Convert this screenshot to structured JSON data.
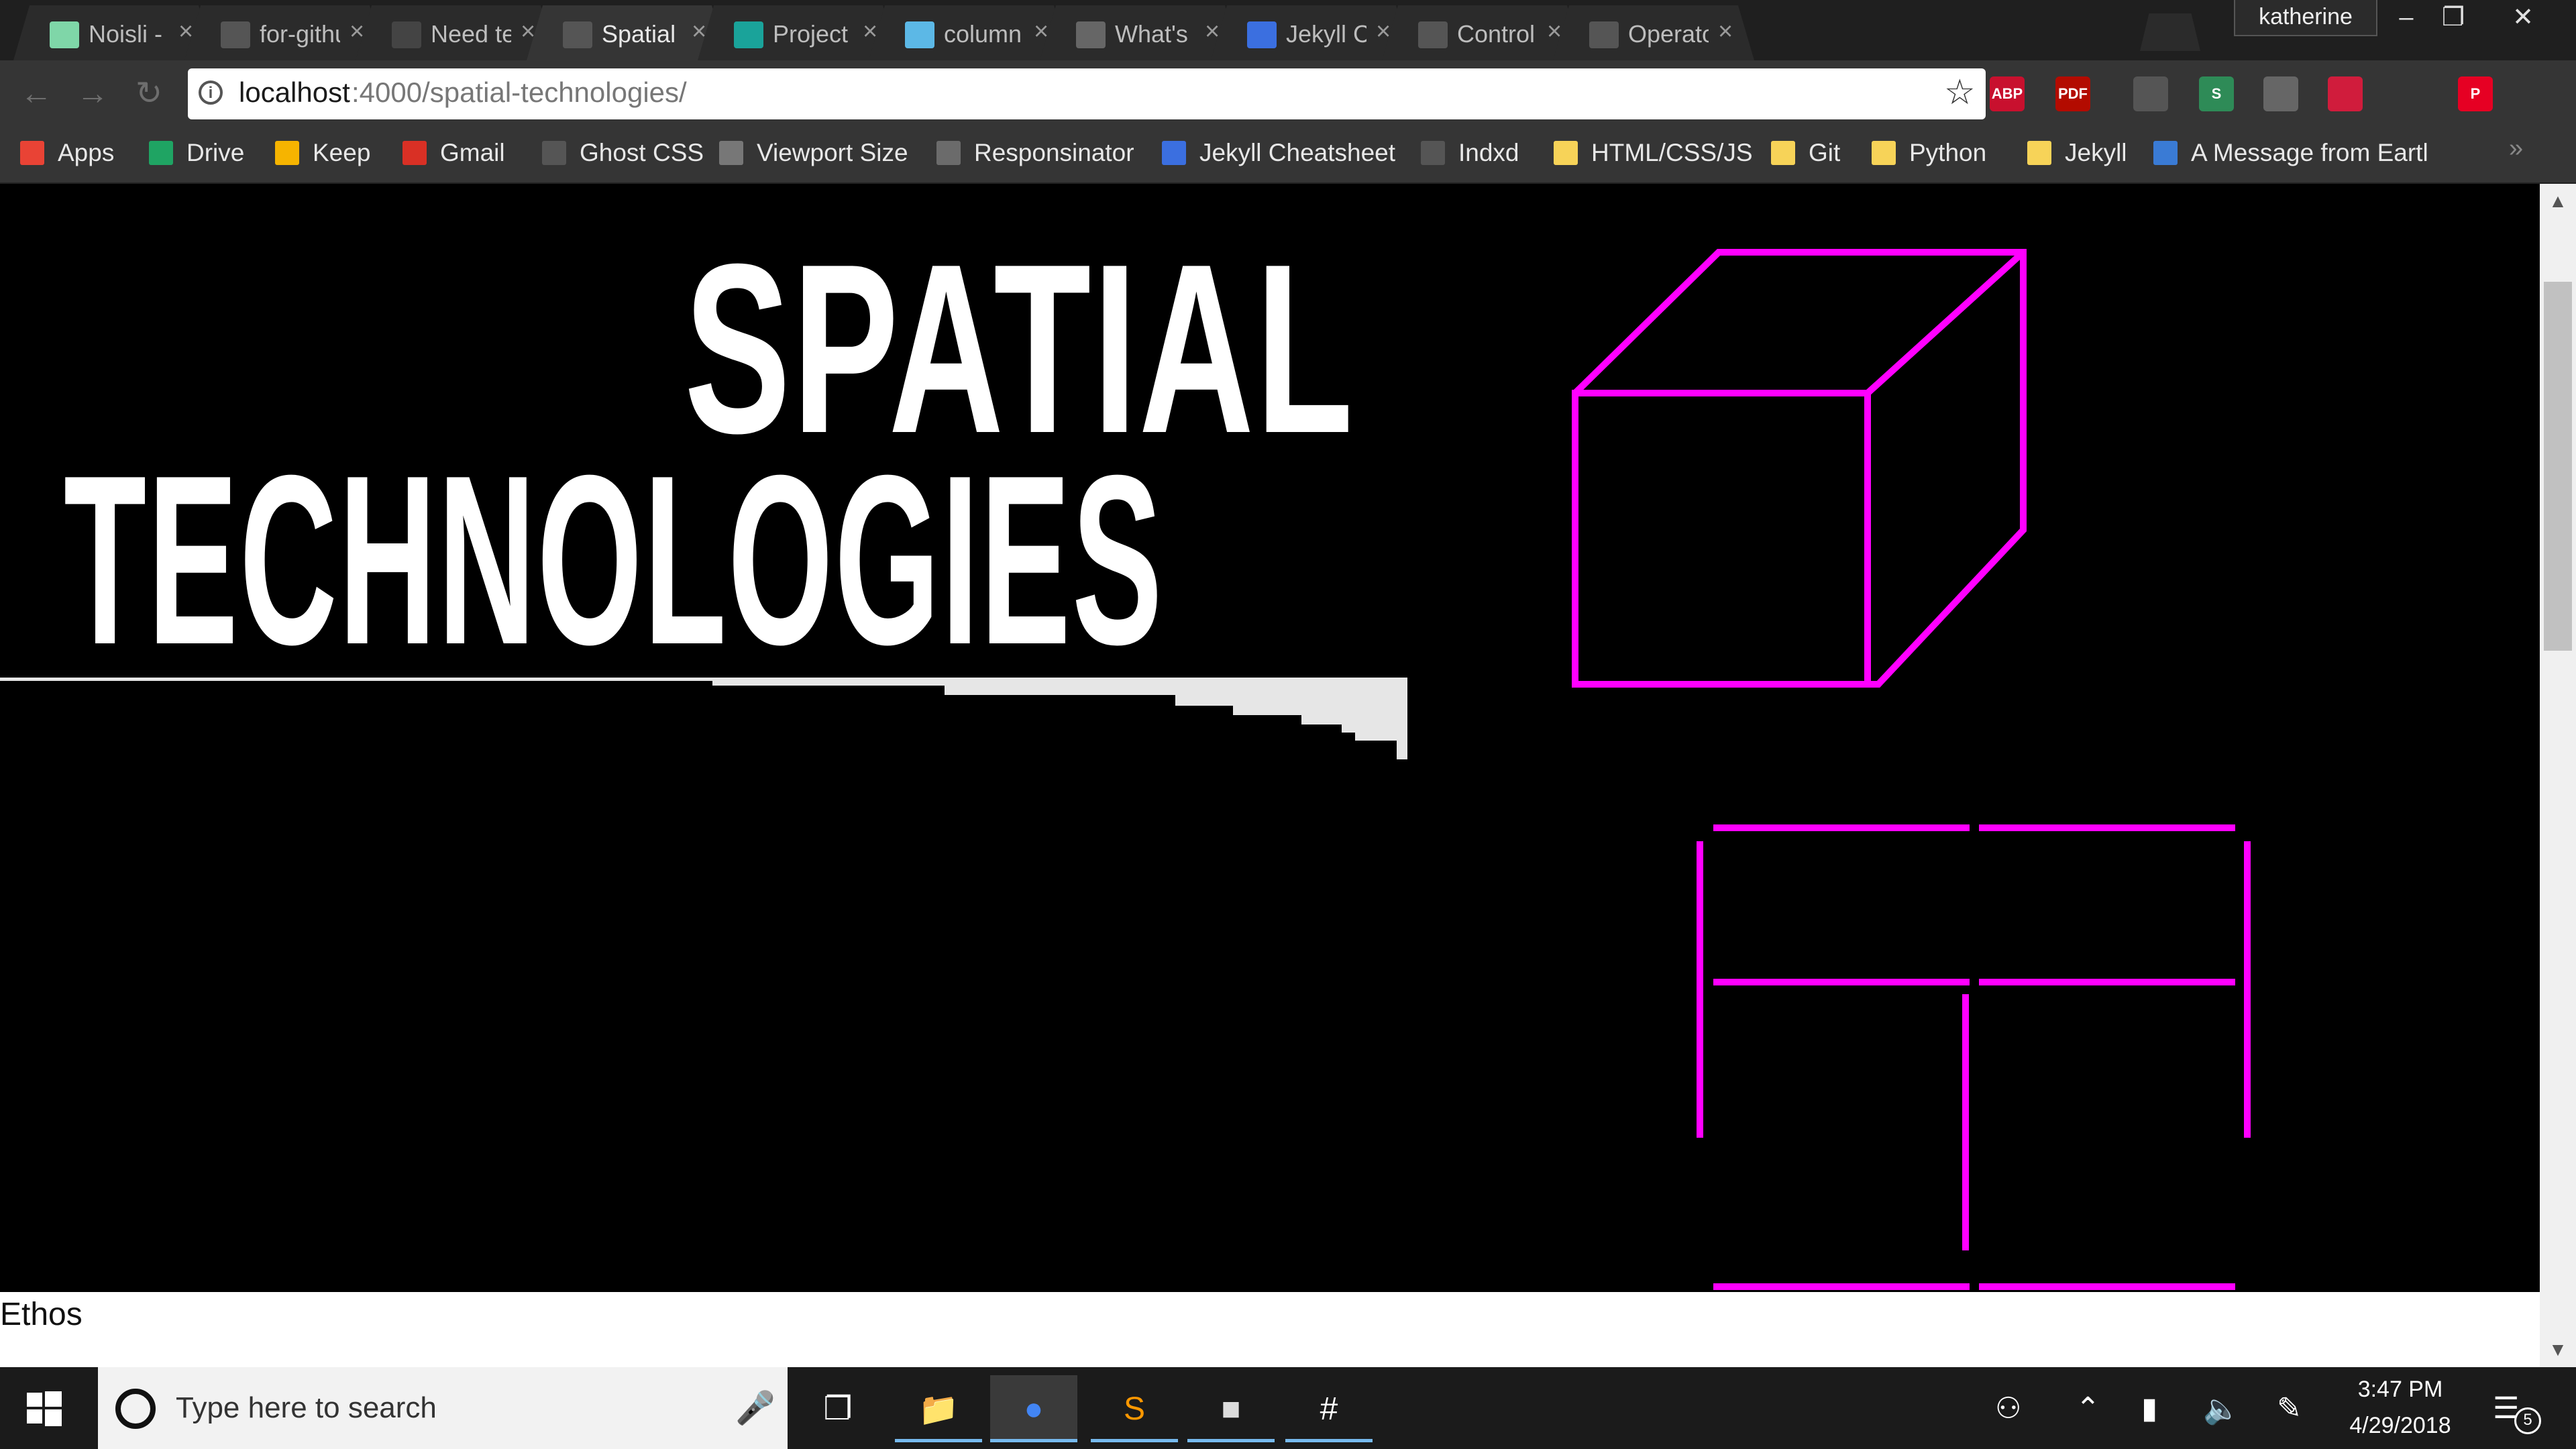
{
  "browser": {
    "tabs": [
      {
        "title": "Noisli - I",
        "favicon": "noisli-icon",
        "color": "#7fd6a8",
        "active": false
      },
      {
        "title": "for-githu",
        "favicon": "page-icon",
        "color": "#555555",
        "active": false
      },
      {
        "title": "Need te",
        "favicon": "github-icon",
        "color": "#444444",
        "active": false
      },
      {
        "title": "Spatial T",
        "favicon": "page-icon",
        "color": "#555555",
        "active": true
      },
      {
        "title": "Project F",
        "favicon": "project-icon",
        "color": "#1aa39a",
        "active": false
      },
      {
        "title": "column",
        "favicon": "codepen-icon",
        "color": "#5cb8e6",
        "active": false
      },
      {
        "title": "What's r",
        "favicon": "dots-icon",
        "color": "#666666",
        "active": false
      },
      {
        "title": "Jekyll Cl",
        "favicon": "jekyll-icon",
        "color": "#3b6fe0",
        "active": false
      },
      {
        "title": "Control",
        "favicon": "drupal-icon",
        "color": "#555555",
        "active": false
      },
      {
        "title": "Operato",
        "favicon": "drupal-icon",
        "color": "#555555",
        "active": false
      }
    ],
    "profile_name": "katherine",
    "url_host": "localhost",
    "url_path": ":4000/spatial-technologies/",
    "extensions": [
      {
        "name": "adblock-icon",
        "label": "ABP",
        "color": "#c8102e"
      },
      {
        "name": "pdf-icon",
        "label": "PDF",
        "color": "#b30b00"
      },
      {
        "name": "magnifier-icon",
        "label": "",
        "color": "#555555"
      },
      {
        "name": "scribe-icon",
        "label": "S",
        "color": "#2e8b57"
      },
      {
        "name": "lightbulb-icon",
        "label": "",
        "color": "#666666"
      },
      {
        "name": "pocket-icon",
        "label": "",
        "color": "#d01c3c"
      },
      {
        "name": "pinterest-icon",
        "label": "P",
        "color": "#e60023"
      }
    ],
    "bookmarks": [
      {
        "label": "Apps",
        "icon": "apps-grid-icon",
        "color": "#e94335"
      },
      {
        "label": "Drive",
        "icon": "drive-icon",
        "color": "#1fa463"
      },
      {
        "label": "Keep",
        "icon": "keep-icon",
        "color": "#f6b400"
      },
      {
        "label": "Gmail",
        "icon": "gmail-icon",
        "color": "#d93025"
      },
      {
        "label": "Ghost CSS",
        "icon": "page-icon",
        "color": "#555555"
      },
      {
        "label": "Viewport Size",
        "icon": "dots-icon",
        "color": "#777777"
      },
      {
        "label": "Responsinator",
        "icon": "r-icon",
        "color": "#6b6b6b"
      },
      {
        "label": "Jekyll Cheatsheet",
        "icon": "jekyll-icon",
        "color": "#3b6fe0"
      },
      {
        "label": "Indxd",
        "icon": "page-icon",
        "color": "#555555"
      },
      {
        "label": "HTML/CSS/JS",
        "icon": "folder-icon",
        "color": "#f7d358"
      },
      {
        "label": "Git",
        "icon": "folder-icon",
        "color": "#f7d358"
      },
      {
        "label": "Python",
        "icon": "folder-icon",
        "color": "#f7d358"
      },
      {
        "label": "Jekyll",
        "icon": "folder-icon",
        "color": "#f7d358"
      },
      {
        "label": "A Message from Eartl",
        "icon": "globe-icon",
        "color": "#3a7bd5"
      }
    ],
    "bookmarks_overflow": "»"
  },
  "page": {
    "hero_line1": "SPATIAL",
    "hero_line2": "TECHNOLOGIES",
    "accent_color": "#ff00ff",
    "section_label": "Ethos"
  },
  "taskbar": {
    "search_placeholder": "Type here to search",
    "time": "3:47 PM",
    "date": "4/29/2018",
    "notification_count": "5",
    "apps": [
      "file-explorer-icon",
      "chrome-icon",
      "sublime-text-icon",
      "terminal-icon",
      "slack-icon"
    ]
  }
}
